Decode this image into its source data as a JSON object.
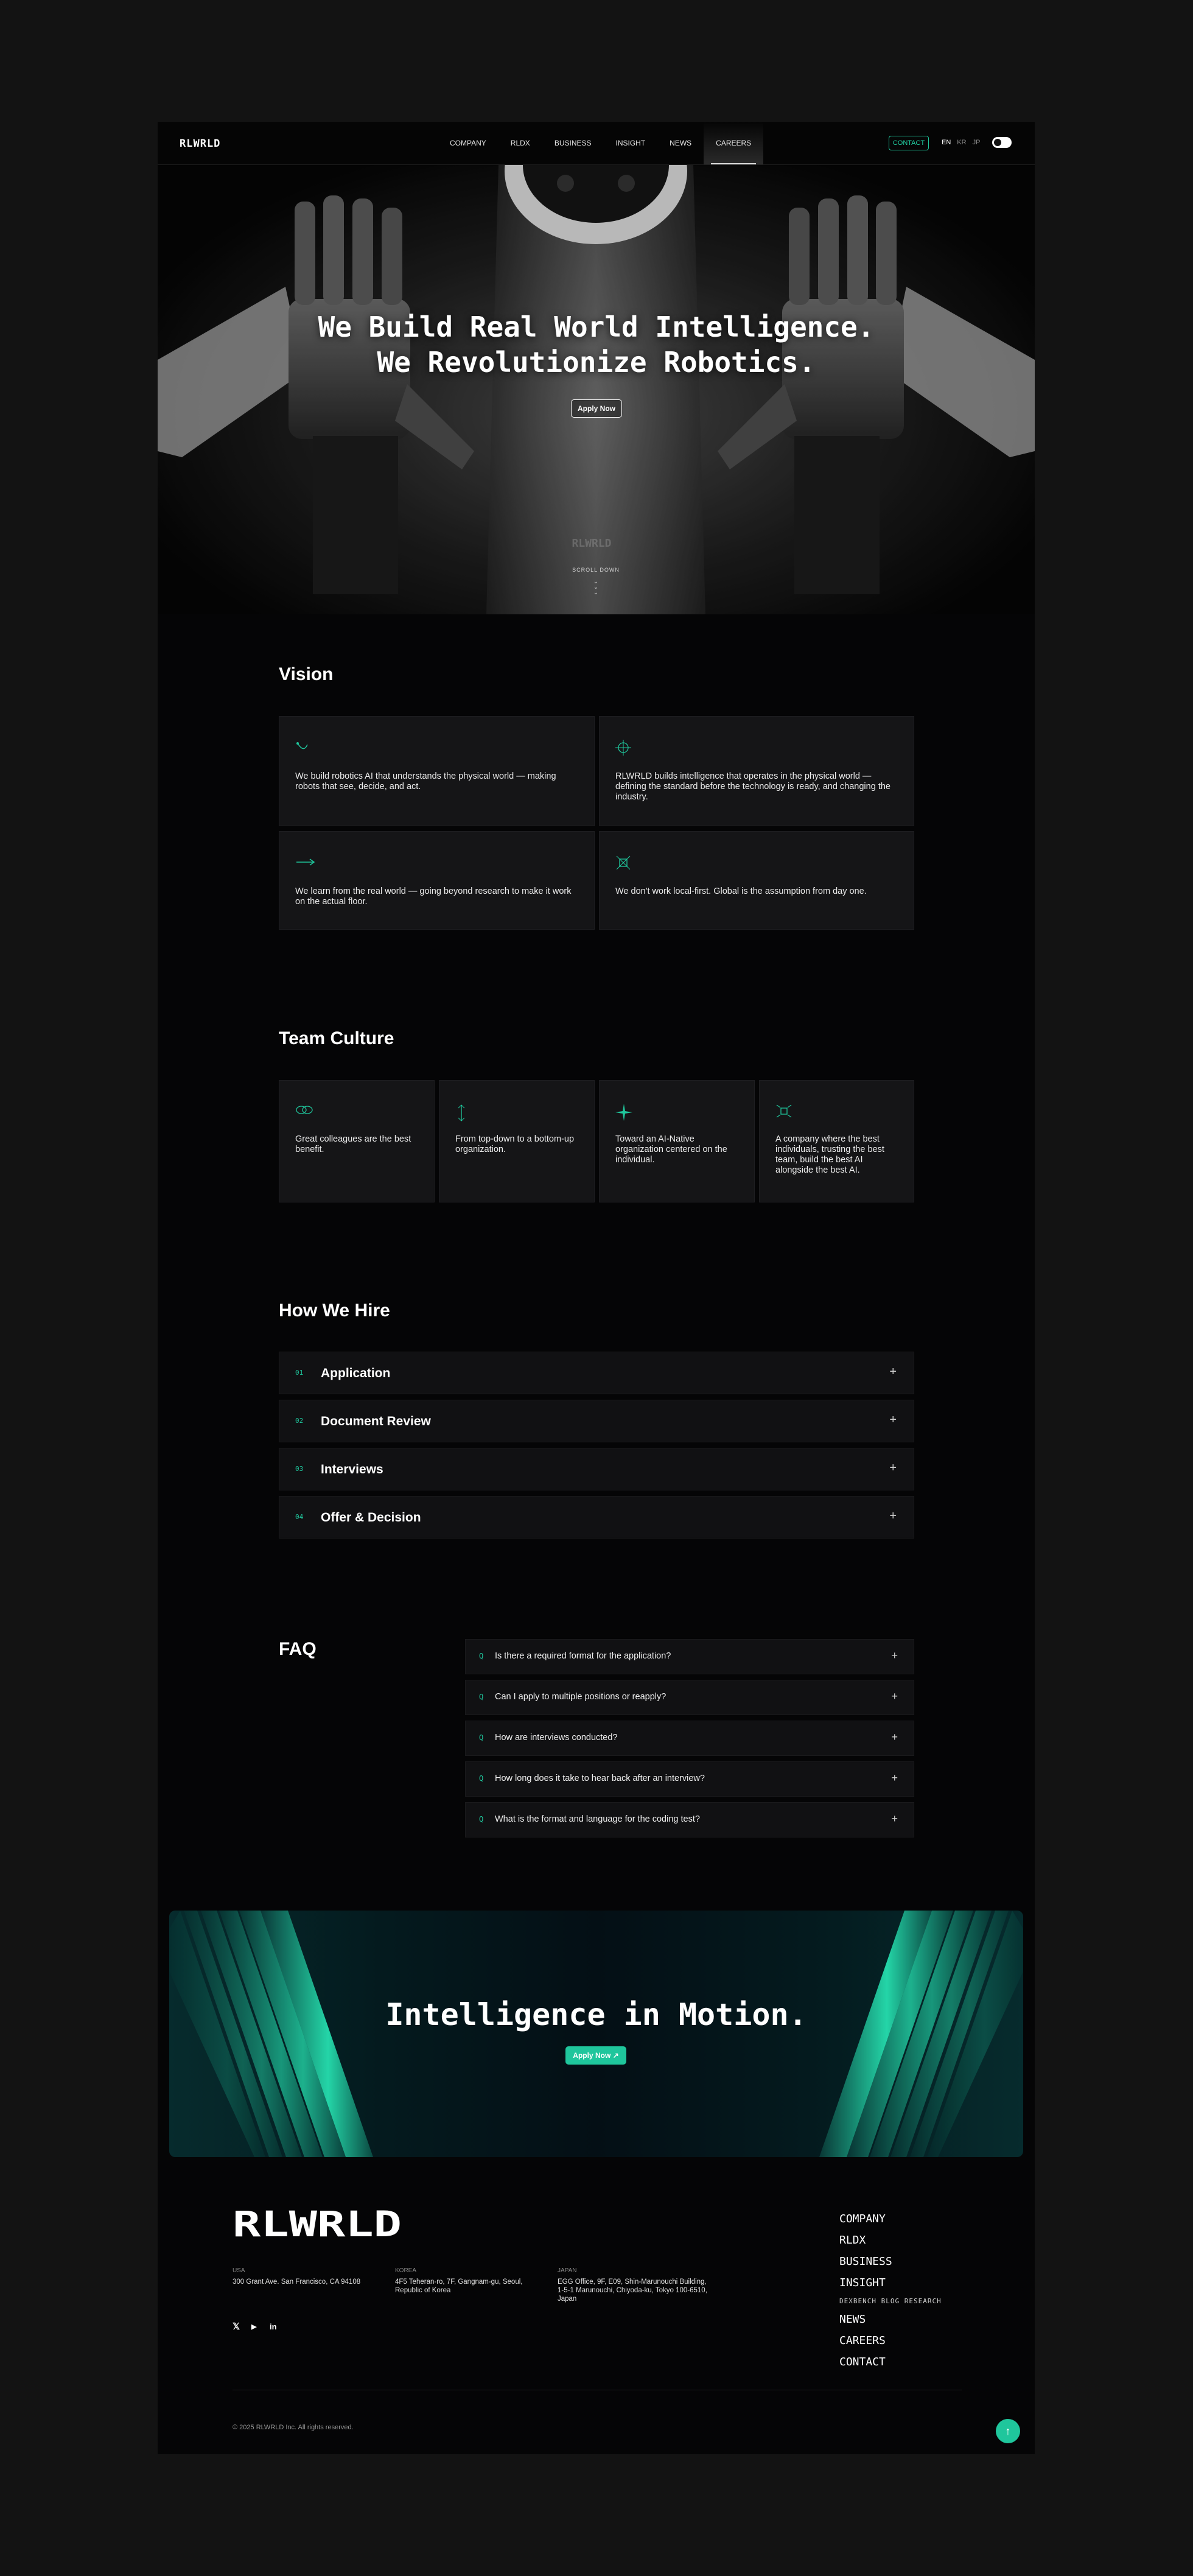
{
  "nav": {
    "logo": "RLWRLD",
    "menu": [
      {
        "label": "COMPANY"
      },
      {
        "label": "RLDX"
      },
      {
        "label": "BUSINESS"
      },
      {
        "label": "INSIGHT"
      },
      {
        "label": "NEWS"
      },
      {
        "label": "CAREERS"
      }
    ],
    "active": "CAREERS",
    "contact": "CONTACT",
    "languages": [
      "EN",
      "KR",
      "JP"
    ],
    "active_language": "EN",
    "theme_toggle": "on"
  },
  "hero": {
    "title_line1": "We Build Real World Intelligence.",
    "title_line2": "We Revolutionize Robotics.",
    "cta": "Apply Now",
    "watermark": "RLWRLD",
    "scroll": "SCROLL DOWN",
    "chevrons": "⌄⌄⌄"
  },
  "vision": {
    "title": "Vision",
    "cards": [
      {
        "icon": "arrow-curve-icon",
        "text": "We build robotics AI that understands the physical world — making robots that see, decide, and act."
      },
      {
        "icon": "crosshair-icon",
        "text": "RLWRLD builds intelligence that operates in the physical world — defining the standard before the technology is ready, and changing the industry."
      },
      {
        "icon": "arrow-right-icon",
        "text": "We learn from the real world — going beyond research to make it work on the actual floor."
      },
      {
        "icon": "target-icon",
        "text": "We don't work local-first. Global is the assumption from day one."
      }
    ]
  },
  "culture": {
    "title": "Team Culture",
    "cards": [
      {
        "icon": "link-icon",
        "text": "Great colleagues are the best benefit."
      },
      {
        "icon": "vertical-arrows-icon",
        "text": "From top-down to a bottom-up organization."
      },
      {
        "icon": "sparkle-icon",
        "text": "Toward an AI-Native organization centered on the individual."
      },
      {
        "icon": "expand-icon",
        "text": "A company where the best individuals, trusting the best team, build the best AI alongside the best AI."
      }
    ]
  },
  "hire": {
    "title": "How We Hire",
    "steps": [
      {
        "num": "01",
        "label": "Application"
      },
      {
        "num": "02",
        "label": "Document Review"
      },
      {
        "num": "03",
        "label": "Interviews"
      },
      {
        "num": "04",
        "label": "Offer & Decision"
      }
    ],
    "expand_glyph": "+"
  },
  "faq": {
    "title": "FAQ",
    "prefix": "Q",
    "items": [
      {
        "q": "Is there a required format for the application?"
      },
      {
        "q": "Can I apply to multiple positions or reapply?"
      },
      {
        "q": "How are interviews conducted?"
      },
      {
        "q": "How long does it take to hear back after an interview?"
      },
      {
        "q": "What is the format and language for the coding test?"
      }
    ],
    "expand_glyph": "+"
  },
  "cta": {
    "title": "Intelligence in Motion.",
    "button": "Apply Now",
    "button_arrow": "↗",
    "accent": "#1fc69c"
  },
  "footer": {
    "logo": "RLWRLD",
    "offices": [
      {
        "region": "USA",
        "address": "300 Grant Ave. San Francisco, CA 94108"
      },
      {
        "region": "KOREA",
        "address": "4F5 Teheran-ro, 7F, Gangnam-gu, Seoul, Republic of Korea"
      },
      {
        "region": "JAPAN",
        "address": "EGG Office, 9F, E09, Shin-Marunouchi Building, 1-5-1 Marunouchi, Chiyoda-ku, Tokyo 100-6510, Japan"
      }
    ],
    "social": [
      {
        "icon": "x-icon",
        "glyph": "𝕏"
      },
      {
        "icon": "youtube-icon",
        "glyph": "▶"
      },
      {
        "icon": "linkedin-icon",
        "glyph": "in"
      }
    ],
    "links": [
      {
        "label": "COMPANY",
        "size": "large"
      },
      {
        "label": "RLDX",
        "size": "large"
      },
      {
        "label": "BUSINESS",
        "size": "large"
      },
      {
        "label": "INSIGHT",
        "size": "large"
      },
      {
        "label": "DEXBENCH BLOG RESEARCH",
        "size": "small"
      },
      {
        "label": "NEWS",
        "size": "large"
      },
      {
        "label": "CAREERS",
        "size": "large"
      },
      {
        "label": "CONTACT",
        "size": "large"
      }
    ],
    "copyright": "© 2025 RLWRLD Inc. All rights reserved.",
    "top_button": "↑"
  },
  "colors": {
    "accent": "#1fc69c",
    "background": "#050506",
    "outer": "#131313",
    "card": "#151517"
  }
}
